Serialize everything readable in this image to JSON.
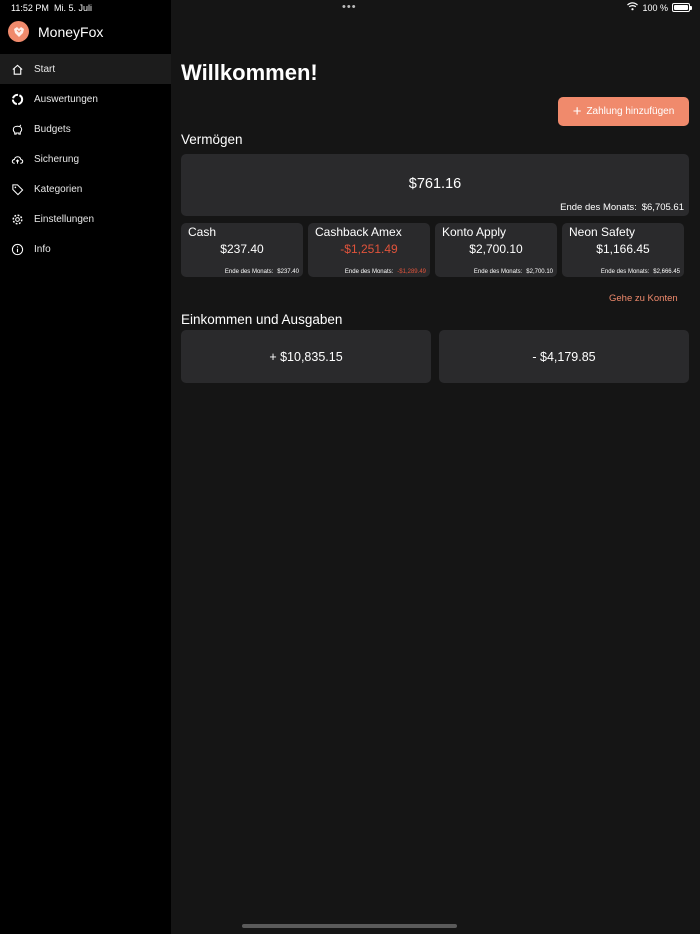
{
  "status_bar": {
    "time": "11:52 PM",
    "date": "Mi. 5. Juli",
    "battery": "100 %",
    "wifi_icon": "wifi-icon",
    "battery_icon": "battery-icon"
  },
  "app": {
    "name": "MoneyFox",
    "logo_icon": "moneyfox-logo",
    "accent_color": "#f08a6c",
    "negative_color": "#e0533b"
  },
  "sidebar": {
    "items": [
      {
        "label": "Start",
        "icon": "home-icon",
        "active": true
      },
      {
        "label": "Auswertungen",
        "icon": "pie-chart-icon",
        "active": false
      },
      {
        "label": "Budgets",
        "icon": "piggy-bank-icon",
        "active": false
      },
      {
        "label": "Sicherung",
        "icon": "cloud-upload-icon",
        "active": false
      },
      {
        "label": "Kategorien",
        "icon": "tag-icon",
        "active": false
      },
      {
        "label": "Einstellungen",
        "icon": "gear-icon",
        "active": false
      },
      {
        "label": "Info",
        "icon": "info-icon",
        "active": false
      }
    ]
  },
  "main": {
    "title": "Willkommen!",
    "add_payment_label": "Zahlung hinzufügen",
    "networth_heading": "Vermögen",
    "networth_value": "$761.16",
    "networth_eom_label": "Ende des Monats:",
    "networth_eom_value": "$6,705.61",
    "accounts": [
      {
        "name": "Cash",
        "value": "$237.40",
        "eom_label": "Ende des Monats:",
        "eom_value": "$237.40",
        "negative": false
      },
      {
        "name": "Cashback Amex",
        "value": "-$1,251.49",
        "eom_label": "Ende des Monats:",
        "eom_value": "-$1,289.49",
        "negative": true
      },
      {
        "name": "Konto Apply",
        "value": "$2,700.10",
        "eom_label": "Ende des Monats:",
        "eom_value": "$2,700.10",
        "negative": false
      },
      {
        "name": "Neon Safety",
        "value": "$1,166.45",
        "eom_label": "Ende des Monats:",
        "eom_value": "$2,666.45",
        "negative": false
      }
    ],
    "goto_accounts_label": "Gehe zu Konten",
    "income_expense_heading": "Einkommen und Ausgaben",
    "income": "+ $10,835.15",
    "expense": "- $4,179.85"
  }
}
